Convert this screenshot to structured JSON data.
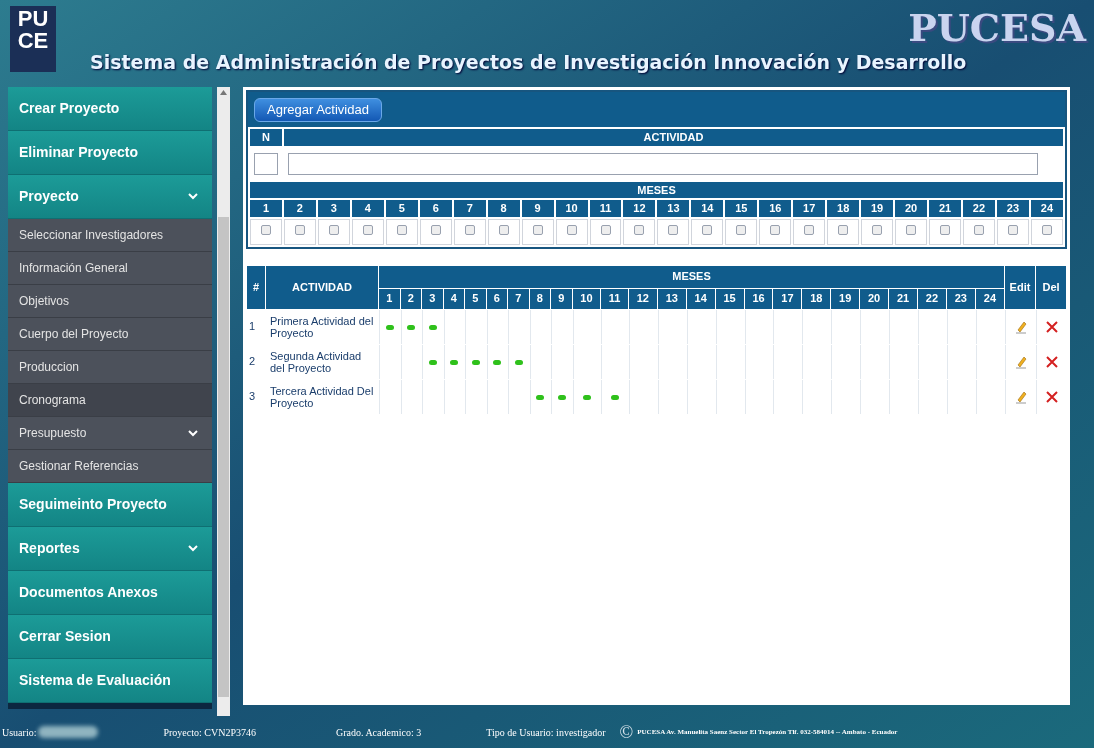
{
  "header": {
    "logo": [
      "PU",
      "CE"
    ],
    "brand": "PUCESA",
    "title": "Sistema de Administración de Proyectos de Investigación Innovación y Desarrollo"
  },
  "sidebar": {
    "items": [
      {
        "label": "Crear Proyecto",
        "kind": "main",
        "caret": false,
        "selected": false
      },
      {
        "label": "Eliminar Proyecto",
        "kind": "main",
        "caret": false,
        "selected": false
      },
      {
        "label": "Proyecto",
        "kind": "main",
        "caret": true,
        "selected": false
      },
      {
        "label": "Seleccionar Investigadores",
        "kind": "sub",
        "caret": false,
        "selected": false
      },
      {
        "label": "Información General",
        "kind": "sub",
        "caret": false,
        "selected": false
      },
      {
        "label": "Objetivos",
        "kind": "sub",
        "caret": false,
        "selected": false
      },
      {
        "label": "Cuerpo del Proyecto",
        "kind": "sub",
        "caret": false,
        "selected": false
      },
      {
        "label": "Produccion",
        "kind": "sub",
        "caret": false,
        "selected": false
      },
      {
        "label": "Cronograma",
        "kind": "sub",
        "caret": false,
        "selected": true
      },
      {
        "label": "Presupuesto",
        "kind": "sub",
        "caret": true,
        "selected": false
      },
      {
        "label": "Gestionar Referencias",
        "kind": "sub",
        "caret": false,
        "selected": false
      },
      {
        "label": "Seguimeinto Proyecto",
        "kind": "main",
        "caret": false,
        "selected": false
      },
      {
        "label": "Reportes",
        "kind": "main",
        "caret": true,
        "selected": false
      },
      {
        "label": "Documentos Anexos",
        "kind": "main",
        "caret": false,
        "selected": false
      },
      {
        "label": "Cerrar Sesion",
        "kind": "main",
        "caret": false,
        "selected": false
      },
      {
        "label": "Sistema de Evaluación",
        "kind": "main",
        "caret": false,
        "selected": false
      }
    ]
  },
  "form": {
    "add_button": "Agregar Actividad",
    "n_header": "N",
    "activity_header": "ACTIVIDAD",
    "months_header": "MESES",
    "months": [
      {
        "label": "1",
        "checked": false
      },
      {
        "label": "2",
        "checked": false
      },
      {
        "label": "3",
        "checked": false
      },
      {
        "label": "4",
        "checked": false
      },
      {
        "label": "5",
        "checked": false
      },
      {
        "label": "6",
        "checked": false
      },
      {
        "label": "7",
        "checked": false
      },
      {
        "label": "8",
        "checked": false
      },
      {
        "label": "9",
        "checked": false
      },
      {
        "label": "10",
        "checked": false
      },
      {
        "label": "11",
        "checked": false
      },
      {
        "label": "12",
        "checked": false
      },
      {
        "label": "13",
        "checked": false
      },
      {
        "label": "14",
        "checked": false
      },
      {
        "label": "15",
        "checked": false
      },
      {
        "label": "16",
        "checked": false
      },
      {
        "label": "17",
        "checked": false
      },
      {
        "label": "18",
        "checked": false
      },
      {
        "label": "19",
        "checked": false
      },
      {
        "label": "20",
        "checked": false
      },
      {
        "label": "21",
        "checked": false
      },
      {
        "label": "22",
        "checked": false
      },
      {
        "label": "23",
        "checked": false
      },
      {
        "label": "24",
        "checked": false
      }
    ]
  },
  "schedule": {
    "columns": {
      "number": "#",
      "activity": "ACTIVIDAD",
      "months": "MESES",
      "edit": "Edit",
      "delete": "Del"
    },
    "month_labels": [
      "1",
      "2",
      "3",
      "4",
      "5",
      "6",
      "7",
      "8",
      "9",
      "10",
      "11",
      "12",
      "13",
      "14",
      "15",
      "16",
      "17",
      "18",
      "19",
      "20",
      "21",
      "22",
      "23",
      "24"
    ],
    "rows": [
      {
        "number": "1",
        "activity": "Primera Actividad del Proyecto",
        "months": [
          true,
          true,
          true,
          false,
          false,
          false,
          false,
          false,
          false,
          false,
          false,
          false,
          false,
          false,
          false,
          false,
          false,
          false,
          false,
          false,
          false,
          false,
          false,
          false
        ]
      },
      {
        "number": "2",
        "activity": "Segunda Actividad del Proyecto",
        "months": [
          false,
          false,
          true,
          true,
          true,
          true,
          true,
          false,
          false,
          false,
          false,
          false,
          false,
          false,
          false,
          false,
          false,
          false,
          false,
          false,
          false,
          false,
          false,
          false
        ]
      },
      {
        "number": "3",
        "activity": "Tercera Actividad Del Proyecto",
        "months": [
          false,
          false,
          false,
          false,
          false,
          false,
          false,
          true,
          true,
          true,
          true,
          false,
          false,
          false,
          false,
          false,
          false,
          false,
          false,
          false,
          false,
          false,
          false,
          false
        ]
      }
    ]
  },
  "status_bar": {
    "user_label": "Usuario:",
    "project": "Proyecto: CVN2P3746",
    "grade": "Grado. Academico: 3",
    "user_type": "Tipo de Usuario: investigador",
    "copyright": "©",
    "address": "PUCESA Av. Manuelita Saenz Sector El Tropezón Tlf. 032-584014 -- Ambato - Ecuador"
  }
}
